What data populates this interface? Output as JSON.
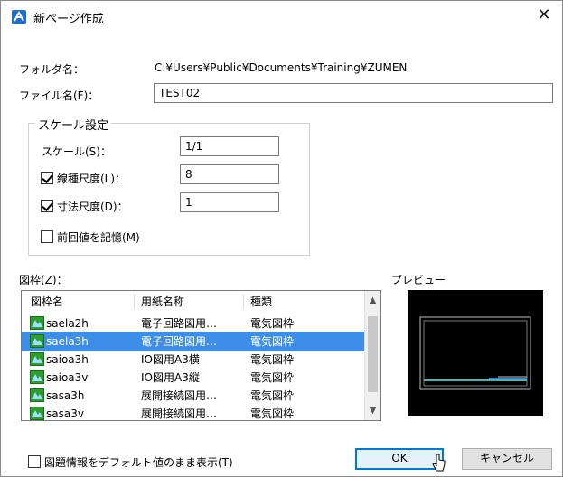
{
  "window": {
    "title": "新ページ作成",
    "close": "✕"
  },
  "folder": {
    "label": "フォルダ名：",
    "path": "C:¥Users¥Public¥Documents¥Training¥ZUMEN"
  },
  "file": {
    "label": "ファイル名(F)：",
    "value": "TEST02"
  },
  "scale_group": {
    "title": "スケール設定",
    "scale": {
      "label": "スケール(S)：",
      "value": "1/1"
    },
    "line_scale": {
      "label": "線種尺度(L)：",
      "checked": true,
      "value": "8"
    },
    "dim_scale": {
      "label": "寸法尺度(D)：",
      "checked": true,
      "value": "1"
    },
    "remember": {
      "label": "前回値を記憶(M)",
      "checked": false
    }
  },
  "frame": {
    "label": "図枠(Z)：",
    "columns": [
      "図枠名",
      "用紙名称",
      "種類"
    ],
    "rows": [
      {
        "name": "saela2h",
        "paper": "電子回路図用…",
        "type": "電気図枠",
        "selected": false
      },
      {
        "name": "saela3h",
        "paper": "電子回路図用…",
        "type": "電気図枠",
        "selected": true
      },
      {
        "name": "saioa3h",
        "paper": "IO図用A3横",
        "type": "電気図枠",
        "selected": false
      },
      {
        "name": "saioa3v",
        "paper": "IO図用A3縦",
        "type": "電気図枠",
        "selected": false
      },
      {
        "name": "sasa3h",
        "paper": "展開接続図用…",
        "type": "電気図枠",
        "selected": false
      },
      {
        "name": "sasa3v",
        "paper": "展開接続図用…",
        "type": "電気図枠",
        "selected": false
      }
    ]
  },
  "preview": {
    "label": "プレビュー"
  },
  "footer": {
    "default_display": {
      "label": "図題情報をデフォルト値のまま表示(T)",
      "checked": false
    },
    "ok": "OK",
    "cancel": "キャンセル"
  },
  "colors": {
    "accent": "#0078d7",
    "selection": "#3d8ee8",
    "preview_bg": "#000000"
  }
}
